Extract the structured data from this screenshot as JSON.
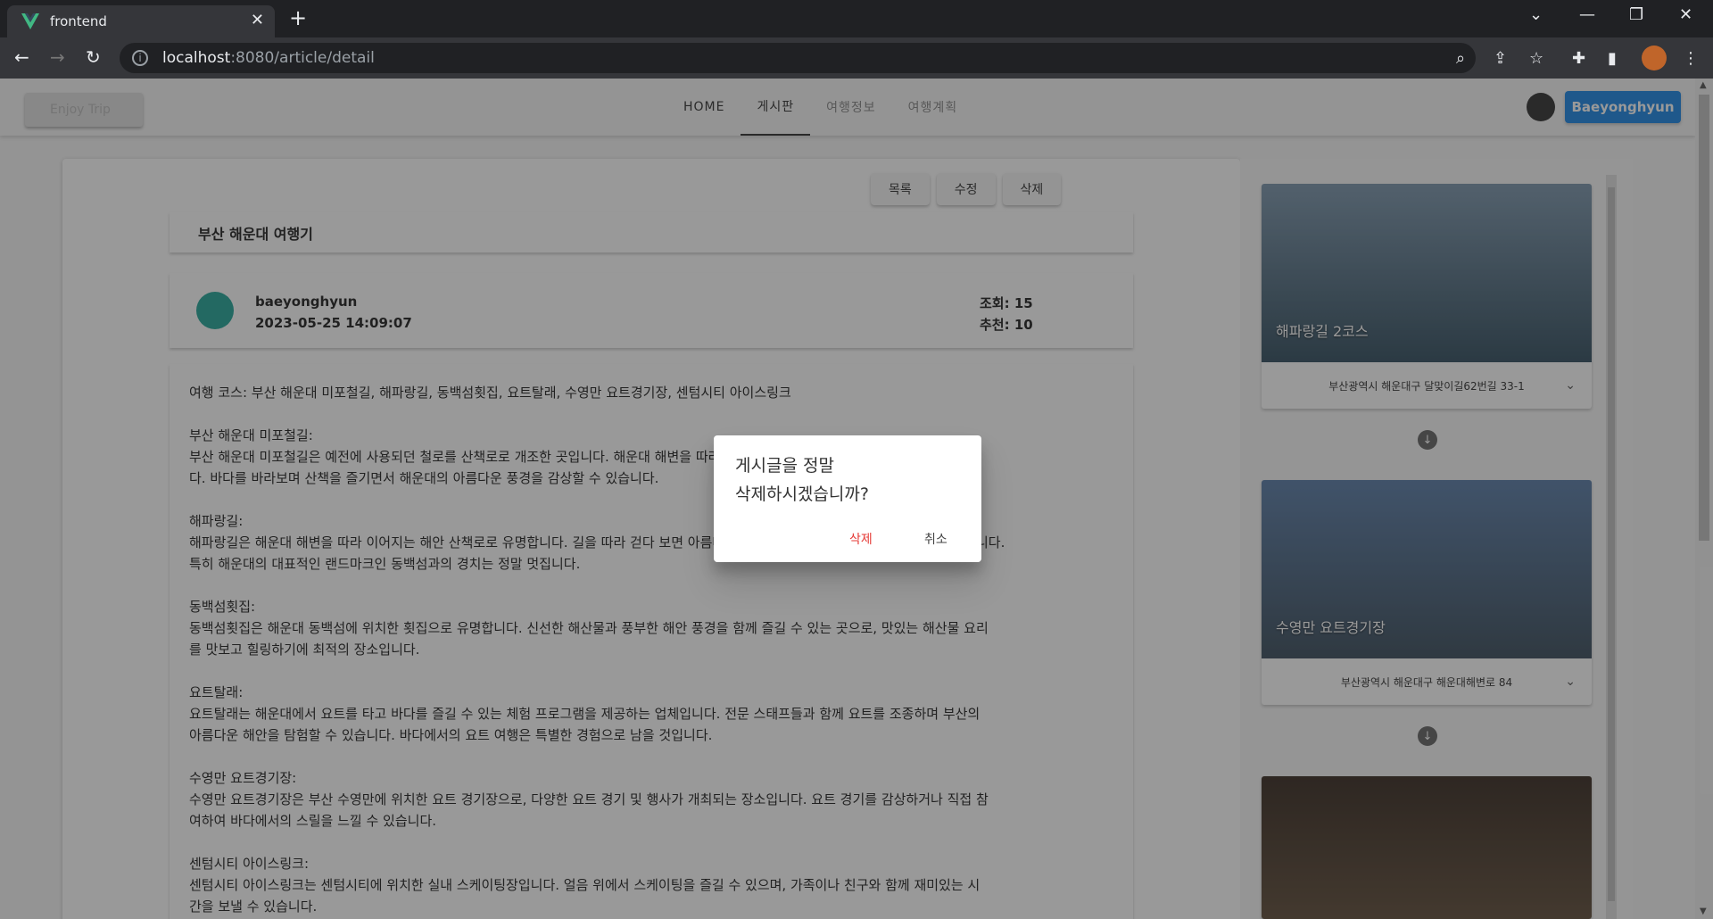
{
  "browser": {
    "tab_title": "frontend",
    "tab_close": "✕",
    "new_tab": "+",
    "url_host": "localhost",
    "url_path": ":8080/article/detail"
  },
  "header": {
    "logo_text": "Enjoy Trip",
    "nav": [
      "HOME",
      "게시판",
      "여행정보",
      "여행계획"
    ],
    "user_button": "Baeyonghyun"
  },
  "actions": {
    "list": "목록",
    "edit": "수정",
    "delete": "삭제"
  },
  "article": {
    "title": "부산 해운대 여행기",
    "author": "baeyonghyun",
    "date": "2023-05-25 14:09:07",
    "views": "조회: 15",
    "recommends": "추천: 10",
    "paragraphs": [
      "여행 코스: 부산 해운대 미포철길, 해파랑길, 동백섬횟집, 요트탈래, 수영만 요트경기장, 센텀시티 아이스링크",
      "부산 해운대 미포철길:\n부산 해운대 미포철길은 예전에 사용되던 철로를 산책로로 개조한 곳입니다. 해운대 해변을 따라 걷기 좋고, 사진 찍기에도 좋은 장소입니\n다. 바다를 바라보며 산책을 즐기면서 해운대의 아름다운 풍경을 감상할 수 있습니다.",
      "해파랑길:\n해파랑길은 해운대 해변을 따라 이어지는 해안 산책로로 유명합니다. 길을 따라 걷다 보면 아름다운 바다 경치를 감상하며 산책을 즐길 수 있습니다.\n특히 해운대의 대표적인 랜드마크인 동백섬과의 경치는 정말 멋집니다.",
      "동백섬횟집:\n동백섬횟집은 해운대 동백섬에 위치한 횟집으로 유명합니다. 신선한 해산물과 풍부한 해안 풍경을 함께 즐길 수 있는 곳으로, 맛있는 해산물 요리\n를 맛보고 힐링하기에 최적의 장소입니다.",
      "요트탈래:\n요트탈래는 해운대에서 요트를 타고 바다를 즐길 수 있는 체험 프로그램을 제공하는 업체입니다. 전문 스태프들과 함께 요트를 조종하며 부산의\n아름다운 해안을 탐험할 수 있습니다. 바다에서의 요트 여행은 특별한 경험으로 남을 것입니다.",
      "수영만 요트경기장:\n수영만 요트경기장은 부산 수영만에 위치한 요트 경기장으로, 다양한 요트 경기 및 행사가 개최되는 장소입니다. 요트 경기를 감상하거나 직접 참\n여하여 바다에서의 스릴을 느낄 수 있습니다.",
      "센텀시티 아이스링크:\n센텀시티 아이스링크는 센텀시티에 위치한 실내 스케이팅장입니다. 얼음 위에서 스케이팅을 즐길 수 있으며, 가족이나 친구와 함께 재미있는 시\n간을 보낼 수 있습니다."
    ]
  },
  "places": [
    {
      "name": "해파랑길 2코스",
      "address": "부산광역시 해운대구 달맞이길62번길 33-1",
      "color_top": "#7d97ad",
      "color_bottom": "#355061"
    },
    {
      "name": "수영만 요트경기장",
      "address": "부산광역시 해운대구 해운대해변로 84",
      "color_top": "#5c7ea8",
      "color_bottom": "#3d4f5e"
    },
    {
      "name": "",
      "address": "",
      "color_top": "#3a2d24",
      "color_bottom": "#6b5742"
    }
  ],
  "dialog": {
    "message": "게시글을 정말\n삭제하시겠습니까?",
    "confirm": "삭제",
    "cancel": "취소"
  },
  "colors": {
    "primary": "#1e88e5",
    "danger": "#e53935",
    "avatar": "#26a69a"
  }
}
